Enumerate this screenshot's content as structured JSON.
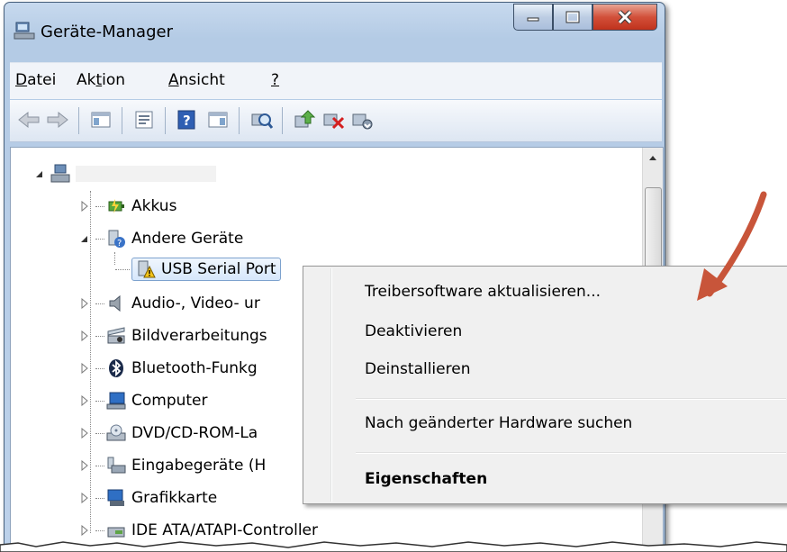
{
  "window": {
    "title": "Geräte-Manager"
  },
  "menu": [
    {
      "pre": "",
      "key": "D",
      "post": "atei"
    },
    {
      "pre": "Ak",
      "key": "t",
      "post": "ion"
    },
    {
      "pre": "",
      "key": "A",
      "post": "nsicht"
    },
    {
      "pre": "",
      "key": "?",
      "post": ""
    }
  ],
  "tree": {
    "items": [
      {
        "label": "Akkus",
        "icon": "battery-icon"
      },
      {
        "label": "Andere Geräte",
        "icon": "unknown-device-icon"
      },
      {
        "label": "USB Serial Port",
        "icon": "warning-device-icon"
      },
      {
        "label": "Audio-, Video- ur",
        "icon": "speaker-icon"
      },
      {
        "label": "Bildverarbeitungs",
        "icon": "scanner-icon"
      },
      {
        "label": "Bluetooth-Funkg",
        "icon": "bluetooth-icon"
      },
      {
        "label": "Computer",
        "icon": "computer-icon"
      },
      {
        "label": "DVD/CD-ROM-La",
        "icon": "dvd-drive-icon"
      },
      {
        "label": "Eingabegeräte (H",
        "icon": "keyboard-icon"
      },
      {
        "label": "Grafikkarte",
        "icon": "display-adapter-icon"
      },
      {
        "label": "IDE ATA/ATAPI-Controller",
        "icon": "ide-controller-icon"
      }
    ]
  },
  "context_menu": {
    "items": [
      {
        "label": "Treibersoftware aktualisieren..."
      },
      {
        "label": "Deaktivieren"
      },
      {
        "label": "Deinstallieren"
      },
      {
        "label": "Nach geänderter Hardware suchen"
      },
      {
        "label": "Eigenschaften",
        "bold": true
      }
    ]
  },
  "colors": {
    "annotation_arrow": "#c8553a"
  }
}
